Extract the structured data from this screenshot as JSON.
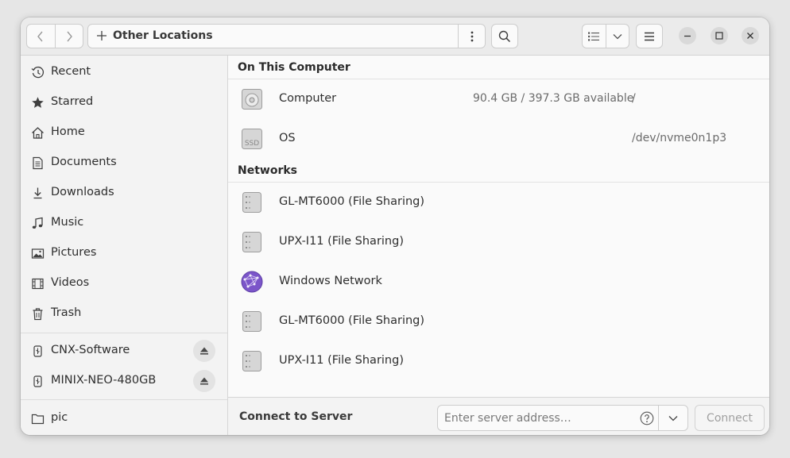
{
  "header": {
    "location": "Other Locations",
    "icons": {
      "back": "chevron-left-icon",
      "forward": "chevron-right-icon",
      "new": "plus-icon",
      "path_menu": "vertical-dots-icon",
      "search": "search-icon",
      "view": "list-view-icon",
      "view_options": "chevron-down-icon",
      "main_menu": "hamburger-icon",
      "minimize": "minimize-icon",
      "maximize": "maximize-icon",
      "close": "close-icon"
    }
  },
  "sidebar": {
    "places": [
      {
        "label": "Recent",
        "icon": "clock-icon"
      },
      {
        "label": "Starred",
        "icon": "star-icon"
      },
      {
        "label": "Home",
        "icon": "home-icon"
      },
      {
        "label": "Documents",
        "icon": "document-icon"
      },
      {
        "label": "Downloads",
        "icon": "download-icon"
      },
      {
        "label": "Music",
        "icon": "music-icon"
      },
      {
        "label": "Pictures",
        "icon": "picture-icon"
      },
      {
        "label": "Videos",
        "icon": "video-icon"
      },
      {
        "label": "Trash",
        "icon": "trash-icon"
      }
    ],
    "devices": [
      {
        "label": "CNX-Software",
        "icon": "usb-drive-icon",
        "eject": "eject-icon"
      },
      {
        "label": "MINIX-NEO-480GB",
        "icon": "usb-drive-icon",
        "eject": "eject-icon"
      }
    ],
    "bookmarks": [
      {
        "label": "pic",
        "icon": "folder-icon"
      }
    ]
  },
  "main": {
    "on_this_computer": {
      "title": "On This Computer",
      "items": [
        {
          "name": "Computer",
          "info": "90.4 GB / 397.3 GB available",
          "path": "/",
          "icon": "hard-disk-icon"
        },
        {
          "name": "OS",
          "info": "",
          "path": "/dev/nvme0n1p3",
          "icon": "ssd-icon",
          "icon_text": "SSD"
        }
      ]
    },
    "networks": {
      "title": "Networks",
      "items": [
        {
          "name": "GL-MT6000 (File Sharing)",
          "icon": "server-icon"
        },
        {
          "name": "UPX-I11 (File Sharing)",
          "icon": "server-icon"
        },
        {
          "name": "Windows Network",
          "icon": "network-globe-icon"
        },
        {
          "name": "GL-MT6000 (File Sharing)",
          "icon": "server-icon"
        },
        {
          "name": "UPX-I11 (File Sharing)",
          "icon": "server-icon"
        }
      ]
    }
  },
  "footer": {
    "label": "Connect to Server",
    "placeholder": "Enter server address…",
    "connect": "Connect"
  }
}
